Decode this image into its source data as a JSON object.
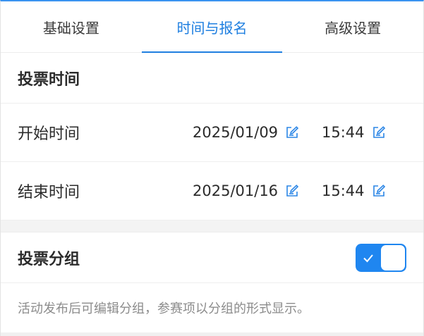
{
  "tabs": [
    {
      "label": "基础设置",
      "active": false
    },
    {
      "label": "时间与报名",
      "active": true
    },
    {
      "label": "高级设置",
      "active": false
    }
  ],
  "vote_time": {
    "title": "投票时间",
    "start": {
      "label": "开始时间",
      "date": "2025/01/09",
      "time": "15:44"
    },
    "end": {
      "label": "结束时间",
      "date": "2025/01/16",
      "time": "15:44"
    }
  },
  "vote_group": {
    "title": "投票分组",
    "enabled": true,
    "hint": "活动发布后可编辑分组，参赛项以分组的形式显示。"
  },
  "colors": {
    "accent": "#1f86f0",
    "tab_active": "#1f7fe0",
    "text": "#2b2b2b",
    "hint": "#8c8c8c"
  }
}
